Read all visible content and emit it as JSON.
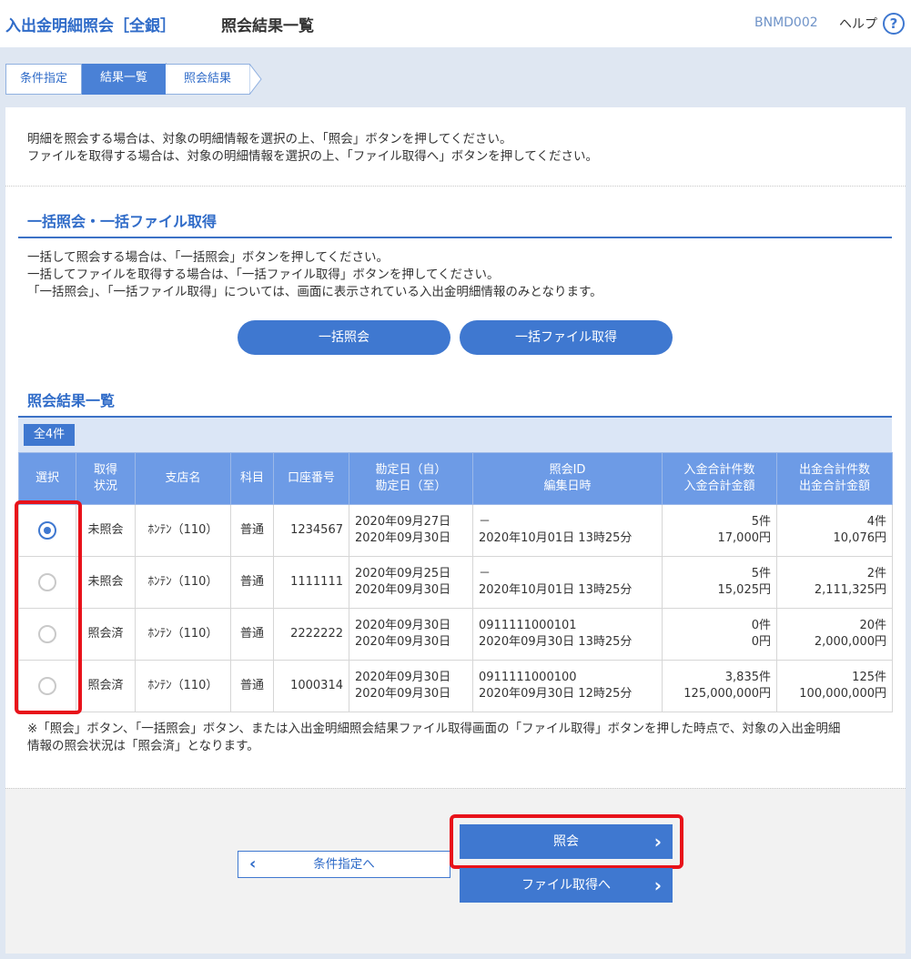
{
  "header": {
    "app_title": "入出金明細照会［全銀］",
    "page_title": "照会結果一覧",
    "screen_id": "BNMD002",
    "help_label": "ヘルプ",
    "help_icon": "?"
  },
  "steps": [
    {
      "label": "条件指定"
    },
    {
      "label": "結果一覧"
    },
    {
      "label": "照会結果"
    }
  ],
  "intro": {
    "line1": "明細を照会する場合は、対象の明細情報を選択の上、「照会」ボタンを押してください。",
    "line2": "ファイルを取得する場合は、対象の明細情報を選択の上、「ファイル取得へ」ボタンを押してください。"
  },
  "bulk": {
    "heading": "一括照会・一括ファイル取得",
    "line1": "一括して照会する場合は、「一括照会」ボタンを押してください。",
    "line2": "一括してファイルを取得する場合は、「一括ファイル取得」ボタンを押してください。",
    "line3": "「一括照会」、「一括ファイル取得」については、画面に表示されている入出金明細情報のみとなります。",
    "bulk_inquiry_label": "一括照会",
    "bulk_file_label": "一括ファイル取得"
  },
  "results": {
    "heading": "照会結果一覧",
    "count_label": "全4件",
    "columns": [
      {
        "line1": "選択",
        "line2": ""
      },
      {
        "line1": "取得",
        "line2": "状況"
      },
      {
        "line1": "支店名",
        "line2": ""
      },
      {
        "line1": "科目",
        "line2": ""
      },
      {
        "line1": "口座番号",
        "line2": ""
      },
      {
        "line1": "勘定日（自）",
        "line2": "勘定日（至）"
      },
      {
        "line1": "照会ID",
        "line2": "編集日時"
      },
      {
        "line1": "入金合計件数",
        "line2": "入金合計金額"
      },
      {
        "line1": "出金合計件数",
        "line2": "出金合計金額"
      }
    ],
    "rows": [
      {
        "selected": true,
        "status": "未照会",
        "branch": "ﾎﾝﾃﾝ（110）",
        "subject": "普通",
        "account": "1234567",
        "date_from": "2020年09月27日",
        "date_to": "2020年09月30日",
        "inquiry_id": "－",
        "edited_at": "2020年10月01日 13時25分",
        "deposit_count": "5件",
        "deposit_amount": "17,000円",
        "withdraw_count": "4件",
        "withdraw_amount": "10,076円"
      },
      {
        "selected": false,
        "status": "未照会",
        "branch": "ﾎﾝﾃﾝ（110）",
        "subject": "普通",
        "account": "1111111",
        "date_from": "2020年09月25日",
        "date_to": "2020年09月30日",
        "inquiry_id": "－",
        "edited_at": "2020年10月01日 13時25分",
        "deposit_count": "5件",
        "deposit_amount": "15,025円",
        "withdraw_count": "2件",
        "withdraw_amount": "2,111,325円"
      },
      {
        "selected": false,
        "status": "照会済",
        "branch": "ﾎﾝﾃﾝ（110）",
        "subject": "普通",
        "account": "2222222",
        "date_from": "2020年09月30日",
        "date_to": "2020年09月30日",
        "inquiry_id": "0911111000101",
        "edited_at": "2020年09月30日 13時25分",
        "deposit_count": "0件",
        "deposit_amount": "0円",
        "withdraw_count": "20件",
        "withdraw_amount": "2,000,000円"
      },
      {
        "selected": false,
        "status": "照会済",
        "branch": "ﾎﾝﾃﾝ（110）",
        "subject": "普通",
        "account": "1000314",
        "date_from": "2020年09月30日",
        "date_to": "2020年09月30日",
        "inquiry_id": "0911111000100",
        "edited_at": "2020年09月30日 12時25分",
        "deposit_count": "3,835件",
        "deposit_amount": "125,000,000円",
        "withdraw_count": "125件",
        "withdraw_amount": "100,000,000円"
      }
    ],
    "note_line1": "※「照会」ボタン、「一括照会」ボタン、または入出金明細照会結果ファイル取得画面の「ファイル取得」ボタンを押した時点で、対象の入出金明細",
    "note_line2": "情報の照会状況は「照会済」となります。"
  },
  "footer": {
    "back_label": "条件指定へ",
    "inquiry_label": "照会",
    "file_label": "ファイル取得へ",
    "chevron_left": "‹",
    "chevron_right": "›"
  },
  "colors": {
    "brand_blue": "#2f6bc8",
    "button_blue": "#3f78d0",
    "table_header": "#6d9be6",
    "highlight_red": "#e8121a"
  }
}
